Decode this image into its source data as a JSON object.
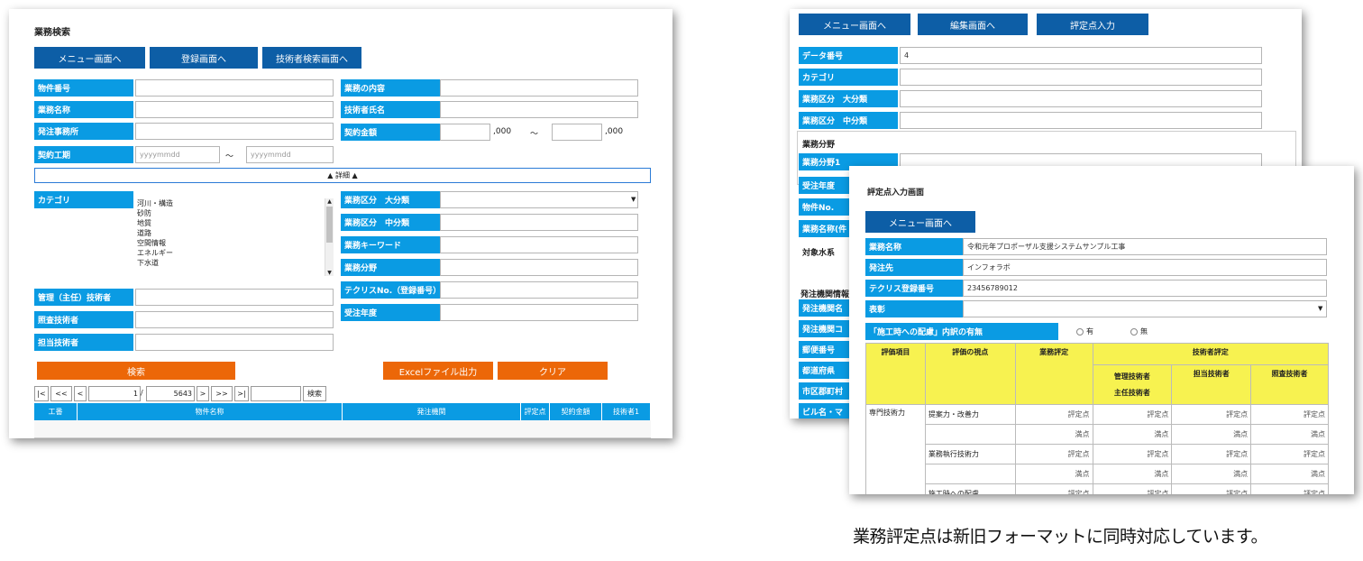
{
  "left": {
    "title": "業務検索",
    "nav": [
      "メニュー画面へ",
      "登録画面へ",
      "技術者検索画面へ"
    ],
    "fields_left": [
      {
        "label": "物件番号",
        "value": ""
      },
      {
        "label": "業務名称",
        "value": ""
      },
      {
        "label": "発注事務所",
        "value": ""
      }
    ],
    "fields_right": [
      {
        "label": "業務の内容",
        "value": ""
      },
      {
        "label": "技術者氏名",
        "value": ""
      }
    ],
    "contract_amount": {
      "label": "契約金額",
      "suffix1": ",000",
      "tilde": "～",
      "suffix2": ",000"
    },
    "contract_period": {
      "label": "契約工期",
      "placeholder_from": "yyyymmdd",
      "tilde": "～",
      "placeholder_to": "yyyymmdd"
    },
    "detail_toggle": "▲ 詳細 ▲",
    "category": {
      "label": "カテゴリ",
      "options": [
        "河川・構造",
        "砂防",
        "地質",
        "道路",
        "空間情報",
        "エネルギー",
        "下水道"
      ]
    },
    "right_lower": [
      {
        "label": "業務区分　大分類",
        "value": "",
        "select": true
      },
      {
        "label": "業務区分　中分類",
        "value": ""
      },
      {
        "label": "業務キーワード",
        "value": ""
      },
      {
        "label": "業務分野",
        "value": ""
      },
      {
        "label": "テクリスNo.（登録番号）",
        "value": ""
      },
      {
        "label": "受注年度",
        "value": ""
      }
    ],
    "engineers": [
      {
        "label": "管理（主任）技術者",
        "value": ""
      },
      {
        "label": "照査技術者",
        "value": ""
      },
      {
        "label": "担当技術者",
        "value": ""
      }
    ],
    "buttons": {
      "search": "検索",
      "excel": "Excelファイル出力",
      "clear": "クリア"
    },
    "pager": {
      "first": "|<",
      "prev2": "<<",
      "prev": "<",
      "page": "1",
      "slash": "/",
      "total": "5643",
      "next": ">",
      "next2": ">>",
      "last": ">|",
      "search": "検索"
    },
    "table_headers": [
      "工番",
      "物件名称",
      "発注機関",
      "評定点",
      "契約金額",
      "技術者1"
    ]
  },
  "right_back": {
    "nav": [
      "メニュー画面へ",
      "編集画面へ",
      "評定点入力"
    ],
    "fields": [
      {
        "label": "データ番号",
        "value": "4"
      },
      {
        "label": "カテゴリ",
        "value": ""
      },
      {
        "label": "業務区分　大分類",
        "value": ""
      },
      {
        "label": "業務区分　中分類",
        "value": ""
      }
    ],
    "section1": "業務分野",
    "field_bunya": {
      "label": "業務分野1",
      "value": ""
    },
    "stubs": [
      "受注年度",
      "物件No.",
      "業務名称(件"
    ],
    "section2": "対象水系",
    "section3": "発注機関情報",
    "stubs2": [
      "発注機関名",
      "発注機関コ",
      "郵便番号",
      "都道府県",
      "市区郡町村",
      "ビル名・マ"
    ]
  },
  "right_front": {
    "title": "評定点入力画面",
    "nav": "メニュー画面へ",
    "fields": [
      {
        "label": "業務名称",
        "value": "令和元年プロポーザル支援システムサンプル工事"
      },
      {
        "label": "発注先",
        "value": "インフォラボ"
      },
      {
        "label": "テクリス登録番号",
        "value": "23456789012"
      },
      {
        "label": "表彰",
        "value": ""
      }
    ],
    "consideration": {
      "label": "「施工時への配慮」内訳の有無",
      "yes": "有",
      "no": "無"
    },
    "table": {
      "h1": "評価項目",
      "h2": "評価の視点",
      "h3": "業務評定",
      "h4": "技術者評定",
      "sub": [
        "管理技術者\n主任技術者",
        "担当技術者",
        "照査技術者"
      ],
      "category": "専門技術力",
      "viewpoints": [
        "提案力・改善力",
        "業務執行技術力",
        "施工時への配慮"
      ],
      "score_label": "評定点",
      "full_label": "満点"
    }
  },
  "caption": "業務評定点は新旧フォーマットに同時対応しています。"
}
